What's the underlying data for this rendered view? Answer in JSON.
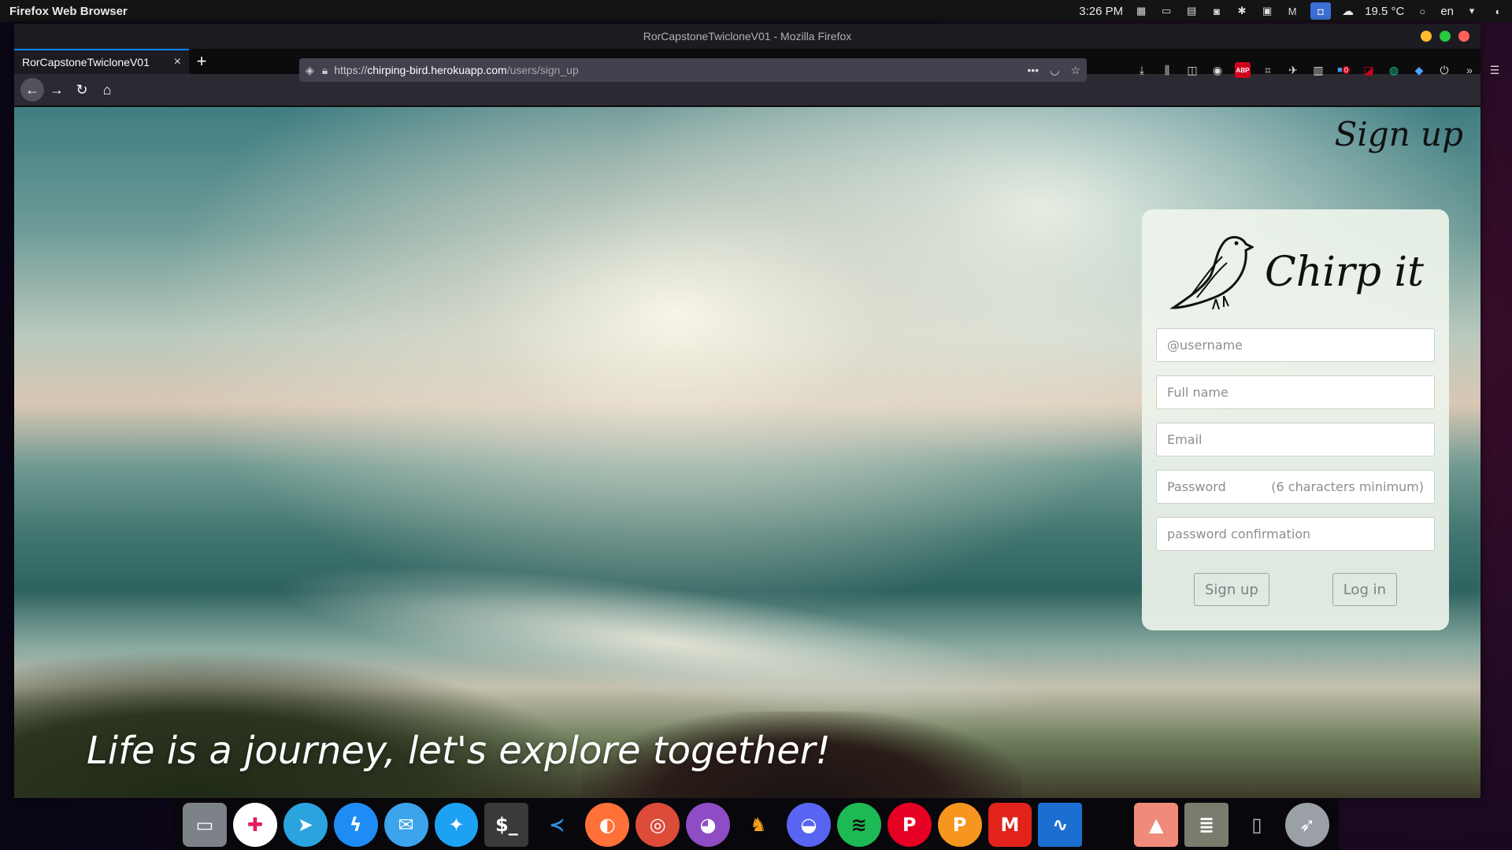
{
  "system_panel": {
    "app_name": "Firefox Web Browser",
    "time": "3:26 PM",
    "weather": "19.5 °C",
    "language": "en"
  },
  "browser": {
    "window_title": "RorCapstoneTwicloneV01 - Mozilla Firefox",
    "tab_title": "RorCapstoneTwicloneV01",
    "tab_close": "×",
    "new_tab": "+",
    "url_scheme": "https://",
    "url_host": "chirping-bird.herokuapp.com",
    "url_path": "/users/sign_up",
    "badge_count": "0"
  },
  "page": {
    "corner_title": "Sign up",
    "logo_text": "Chirp it",
    "tagline": "Life is a journey, let's explore together!",
    "form": {
      "username_placeholder": "@username",
      "fullname_placeholder": "Full name",
      "email_placeholder": "Email",
      "password_placeholder": "Password",
      "password_hint": "(6 characters minimum)",
      "confirmation_placeholder": "password confirmation",
      "signup_label": "Sign up",
      "login_label": "Log in"
    }
  },
  "dock": {
    "items": [
      "files",
      "slack",
      "telegram",
      "messenger",
      "mail",
      "twitter",
      "terminal",
      "vscode",
      "firefox",
      "chrome",
      "github",
      "kangaroo",
      "discord",
      "spotify",
      "pinterest",
      "p-app",
      "m-app",
      "monitor",
      "photos",
      "server",
      "trash",
      "launcher"
    ]
  },
  "colors": {
    "accent": "#0a84ff",
    "window_close": "#ff5f57",
    "window_max": "#28c840",
    "window_min": "#febc2e"
  }
}
